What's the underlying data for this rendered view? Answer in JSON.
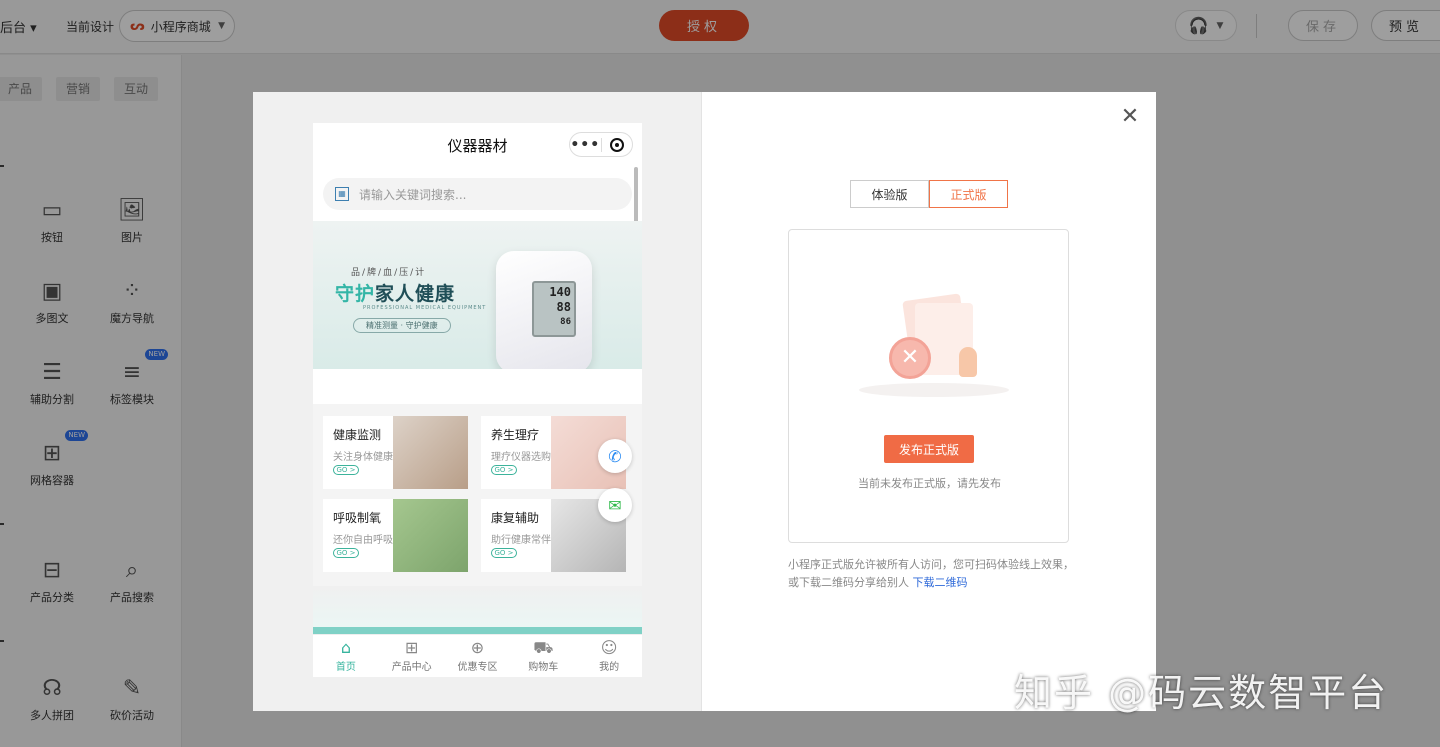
{
  "topbar": {
    "back_label": "后台",
    "current_design_label": "当前设计",
    "design_select": "小程序商城",
    "authorize_label": "授权",
    "save_label": "保存",
    "preview_label": "预览"
  },
  "left_panel": {
    "tabs": [
      "产品",
      "营销",
      "互动"
    ],
    "components": [
      {
        "label": "按钮",
        "icon": "button-icon"
      },
      {
        "label": "图片",
        "icon": "image-icon"
      },
      {
        "label": "多图文",
        "icon": "multi-image-text-icon"
      },
      {
        "label": "魔方导航",
        "icon": "grid-nav-icon"
      },
      {
        "label": "辅助分割",
        "icon": "divider-icon"
      },
      {
        "label": "标签模块",
        "icon": "tab-module-icon",
        "badge": "NEW"
      },
      {
        "label": "网格容器",
        "icon": "grid-container-icon",
        "badge": "NEW"
      },
      {
        "label": "产品分类",
        "icon": "category-icon"
      },
      {
        "label": "产品搜索",
        "icon": "product-search-icon"
      },
      {
        "label": "多人拼团",
        "icon": "group-buy-icon"
      },
      {
        "label": "砍价活动",
        "icon": "bargain-icon"
      }
    ]
  },
  "phone": {
    "title": "仪器器材",
    "search_placeholder": "请输入关键词搜索...",
    "banner": {
      "tagline": "品/牌/血/压/计",
      "headline_accent": "守护",
      "headline": "家人健康",
      "english": "PROFESSIONAL MEDICAL EQUIPMENT",
      "pill": "精准测量 · 守护健康",
      "reading_sys": "140",
      "reading_dia": "88",
      "reading_pulse": "86"
    },
    "cards": [
      {
        "title": "健康监测",
        "sub": "关注身体健康",
        "go": "GO >"
      },
      {
        "title": "养生理疗",
        "sub": "理疗仪器选购",
        "go": "GO >"
      },
      {
        "title": "呼吸制氧",
        "sub": "还你自由呼吸",
        "go": "GO >"
      },
      {
        "title": "康复辅助",
        "sub": "助行健康常伴",
        "go": "GO >"
      }
    ],
    "tabs": [
      {
        "label": "首页",
        "icon": "home-icon"
      },
      {
        "label": "产品中心",
        "icon": "grid-icon"
      },
      {
        "label": "优惠专区",
        "icon": "gift-icon"
      },
      {
        "label": "购物车",
        "icon": "cart-icon"
      },
      {
        "label": "我的",
        "icon": "user-icon"
      }
    ]
  },
  "right": {
    "trial_label": "体验版",
    "official_label": "正式版",
    "publish_button": "发布正式版",
    "hint": "当前未发布正式版，请先发布",
    "description": "小程序正式版允许被所有人访问，您可扫码体验线上效果，或下载二维码分享给别人",
    "download_link": "下载二维码"
  },
  "watermark": "知乎 @码云数智平台",
  "colors": {
    "accent": "#f06b45",
    "brand_teal": "#37b49e",
    "authorize": "#e24b27"
  }
}
